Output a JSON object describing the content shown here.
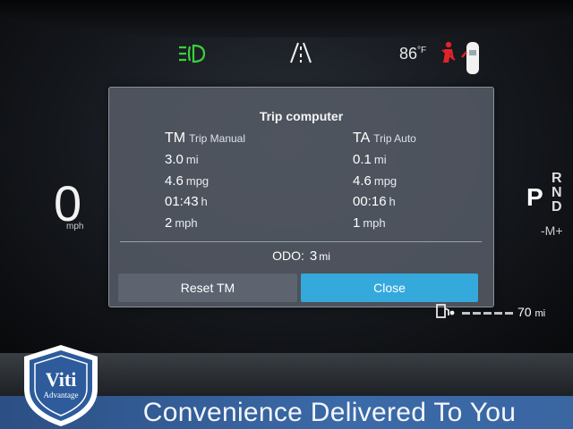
{
  "status_bar": {
    "icons": [
      "headlight-icon",
      "lane-assist-icon",
      "seatbelt-warning-icon",
      "door-open-icon"
    ],
    "temperature": "86",
    "temperature_unit": "°F"
  },
  "speed": {
    "value": "0",
    "unit": "mph"
  },
  "gear": {
    "selected": "P",
    "options": [
      "R",
      "N",
      "D"
    ],
    "manual": "-M+"
  },
  "trip_computer": {
    "title": "Trip computer",
    "manual": {
      "code": "TM",
      "name": "Trip Manual",
      "rows": [
        {
          "value": "3.0",
          "unit": "mi"
        },
        {
          "value": "4.6",
          "unit": "mpg"
        },
        {
          "value": "01:43",
          "unit": "h"
        },
        {
          "value": "2",
          "unit": "mph"
        }
      ]
    },
    "auto": {
      "code": "TA",
      "name": "Trip Auto",
      "rows": [
        {
          "value": "0.1",
          "unit": "mi"
        },
        {
          "value": "4.6",
          "unit": "mpg"
        },
        {
          "value": "00:16",
          "unit": "h"
        },
        {
          "value": "1",
          "unit": "mph"
        }
      ]
    },
    "odo": {
      "label": "ODO:",
      "value": "3",
      "unit": "mi"
    },
    "buttons": {
      "reset": "Reset TM",
      "close": "Close"
    }
  },
  "range": {
    "value": "70",
    "unit": "mi"
  },
  "banner": {
    "logo_text": "Viti",
    "logo_subtext": "Advantage",
    "tagline": "Convenience Delivered To You"
  },
  "colors": {
    "headlight": "#3ad13a",
    "warning": "#e0242a",
    "close_button": "#35a8dc",
    "banner": "#3b6aa8"
  }
}
